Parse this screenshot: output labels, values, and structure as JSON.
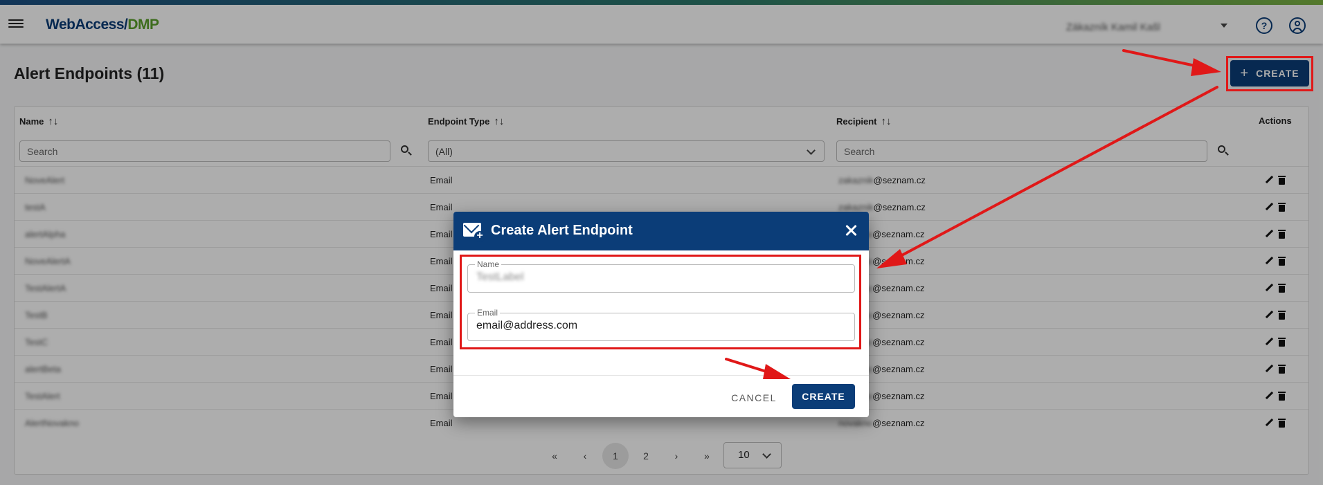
{
  "header": {
    "logo_main": "WebAccess/",
    "logo_suffix": "DMP",
    "user_name": "Zákazník Kamil Kašl"
  },
  "page": {
    "title": "Alert Endpoints (11)",
    "create_label": "CREATE"
  },
  "table": {
    "columns": [
      {
        "label": "Name",
        "sortable": true
      },
      {
        "label": "Endpoint Type",
        "sortable": true
      },
      {
        "label": "Recipient",
        "sortable": true
      },
      {
        "label": "Actions",
        "sortable": false
      }
    ],
    "filters": {
      "name_placeholder": "Search",
      "type_selected": "(All)",
      "recipient_placeholder": "Search"
    },
    "rows": [
      {
        "name": "NoveAlert",
        "type": "Email",
        "recipient_user": "zakaznik",
        "recipient_domain": "@seznam.cz"
      },
      {
        "name": "testA",
        "type": "Email",
        "recipient_user": "zakaznik",
        "recipient_domain": "@seznam.cz"
      },
      {
        "name": "alertAlpha",
        "type": "Email",
        "recipient_user": "novakno",
        "recipient_domain": "@seznam.cz"
      },
      {
        "name": "NoveAlertA",
        "type": "Email",
        "recipient_user": "novakno",
        "recipient_domain": "@seznam.cz"
      },
      {
        "name": "TestAlertA",
        "type": "Email",
        "recipient_user": "novakno",
        "recipient_domain": "@seznam.cz"
      },
      {
        "name": "TestB",
        "type": "Email",
        "recipient_user": "novakno",
        "recipient_domain": "@seznam.cz"
      },
      {
        "name": "TestC",
        "type": "Email",
        "recipient_user": "novakno",
        "recipient_domain": "@seznam.cz"
      },
      {
        "name": "alertBeta",
        "type": "Email",
        "recipient_user": "novakno",
        "recipient_domain": "@seznam.cz"
      },
      {
        "name": "TestAlert",
        "type": "Email",
        "recipient_user": "novakno",
        "recipient_domain": "@seznam.cz"
      },
      {
        "name": "AlertNovakno",
        "type": "Email",
        "recipient_user": "novakno",
        "recipient_domain": "@seznam.cz"
      }
    ]
  },
  "pagination": {
    "first": "«",
    "prev": "‹",
    "pages": [
      "1",
      "2"
    ],
    "active_page": "1",
    "next": "›",
    "last": "»",
    "page_size": "10"
  },
  "dialog": {
    "title": "Create Alert Endpoint",
    "name_label": "Name",
    "name_value": "TestLabel",
    "email_label": "Email",
    "email_value": "email@address.com",
    "cancel_label": "CANCEL",
    "create_label": "CREATE"
  },
  "colors": {
    "primary": "#0b3d78",
    "accent_green": "#5aa02c",
    "annotation_red": "#e01818"
  },
  "icons": [
    "menu-icon",
    "chevron-down-icon",
    "help-icon",
    "account-icon",
    "plus-icon",
    "sort-icon",
    "search-icon",
    "pencil-icon",
    "trash-icon",
    "mail-plus-icon",
    "close-icon"
  ]
}
